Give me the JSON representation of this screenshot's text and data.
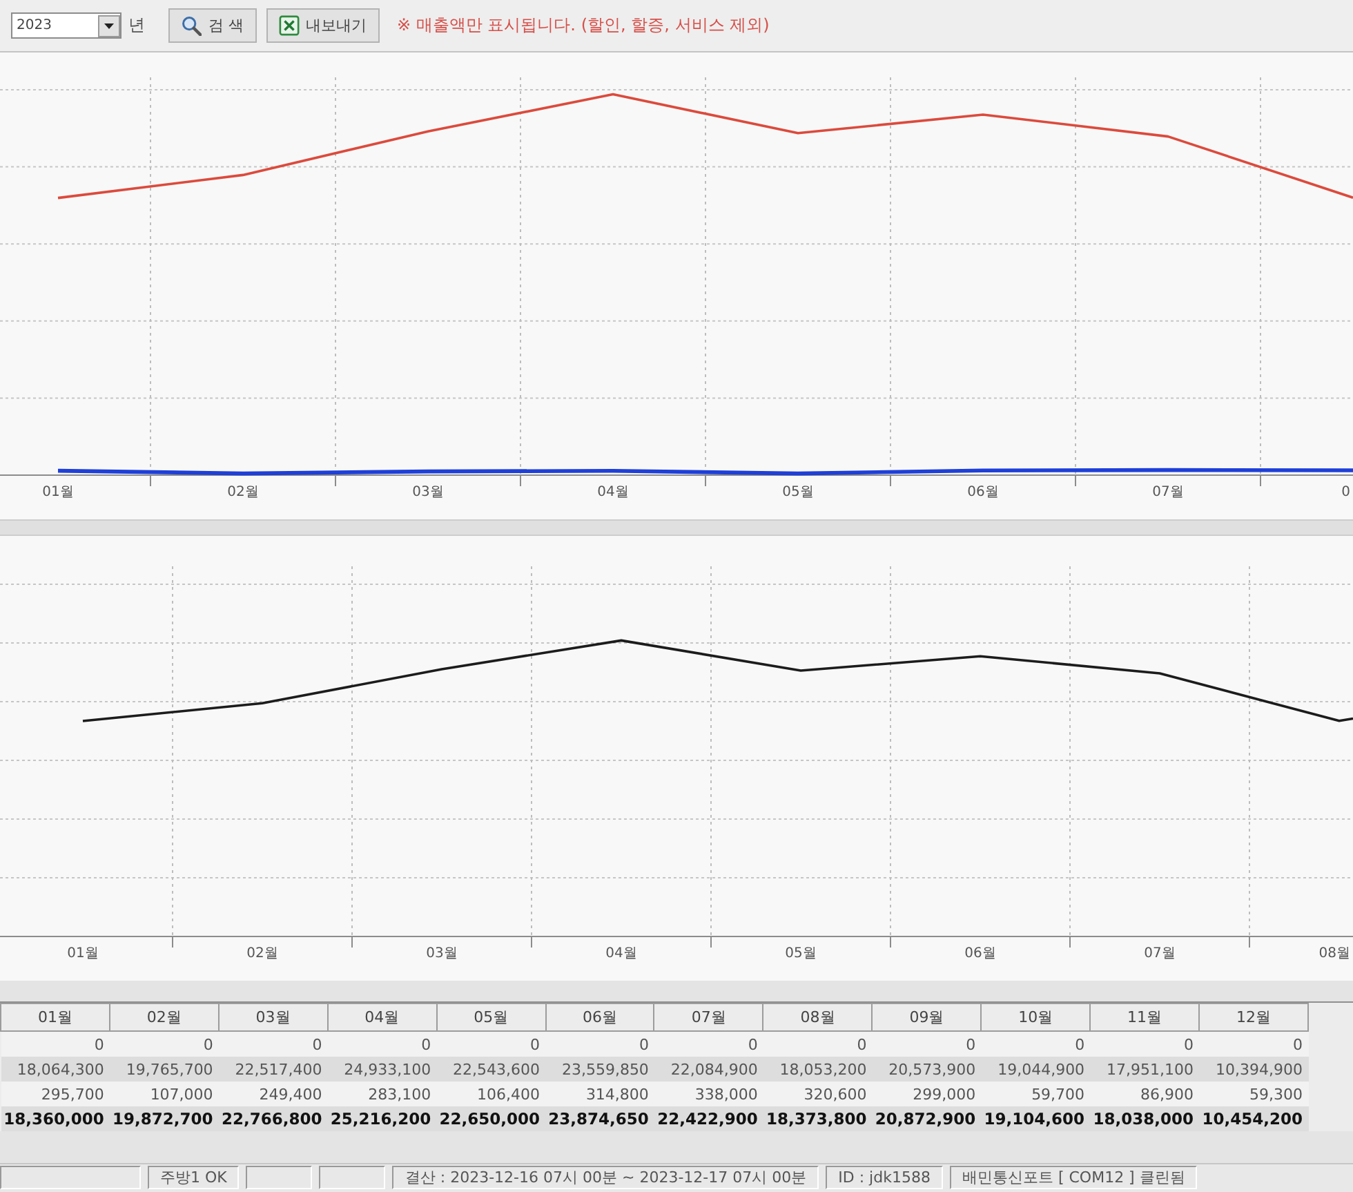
{
  "toolbar": {
    "year_select": {
      "value": "2023"
    },
    "year_unit": "년",
    "buttons": [
      {
        "kind": "search",
        "label": "검 색"
      },
      {
        "kind": "export",
        "label": "내보내기"
      }
    ],
    "notice": "※ 매출액만 표시됩니다. (할인, 할증, 서비스 제외)"
  },
  "upper_chart": {
    "x_labels": [
      "01월",
      "02월",
      "03월",
      "04월",
      "05월",
      "06월",
      "07월",
      "0"
    ],
    "lines": [
      {
        "kind": "total",
        "color": "#dc4a3c"
      },
      {
        "kind": "extra",
        "color": "#1e3fd8"
      }
    ]
  },
  "lower_chart": {
    "x_labels": [
      "01월",
      "02월",
      "03월",
      "04월",
      "05월",
      "06월",
      "07월",
      "08월"
    ],
    "lines": [
      {
        "kind": "total",
        "color": "#1c1c1c"
      }
    ]
  },
  "table": {
    "columns": [
      "01월",
      "02월",
      "03월",
      "04월",
      "05월",
      "06월",
      "07월",
      "08월",
      "09월",
      "10월",
      "11월",
      "12월"
    ],
    "rows": [
      {
        "kind": "zero",
        "cells": [
          "0",
          "0",
          "0",
          "0",
          "0",
          "0",
          "0",
          "0",
          "0",
          "0",
          "0",
          "0"
        ]
      },
      {
        "kind": "sales",
        "cells": [
          "18,064,300",
          "19,765,700",
          "22,517,400",
          "24,933,100",
          "22,543,600",
          "23,559,850",
          "22,084,900",
          "18,053,200",
          "20,573,900",
          "19,044,900",
          "17,951,100",
          "10,394,900"
        ]
      },
      {
        "kind": "extra",
        "cells": [
          "295,700",
          "107,000",
          "249,400",
          "283,100",
          "106,400",
          "314,800",
          "338,000",
          "320,600",
          "299,000",
          "59,700",
          "86,900",
          "59,300"
        ]
      },
      {
        "kind": "total",
        "cells": [
          "18,360,000",
          "19,872,700",
          "22,766,800",
          "25,216,200",
          "22,650,000",
          "23,874,650",
          "22,422,900",
          "18,373,800",
          "20,872,900",
          "19,104,600",
          "18,038,000",
          "10,454,200"
        ]
      }
    ]
  },
  "status_bar": {
    "panels": [
      {
        "kind": "blank"
      },
      {
        "kind": "text",
        "text": "주방1 OK"
      },
      {
        "kind": "blank"
      },
      {
        "kind": "blank"
      },
      {
        "kind": "text",
        "text": "결산 : 2023-12-16 07시 00분 ~ 2023-12-17 07시 00분"
      },
      {
        "kind": "text",
        "text": "ID : jdk1588"
      },
      {
        "kind": "text",
        "text": "배민통신포트 [ COM12 ] 클린됨"
      }
    ]
  }
}
